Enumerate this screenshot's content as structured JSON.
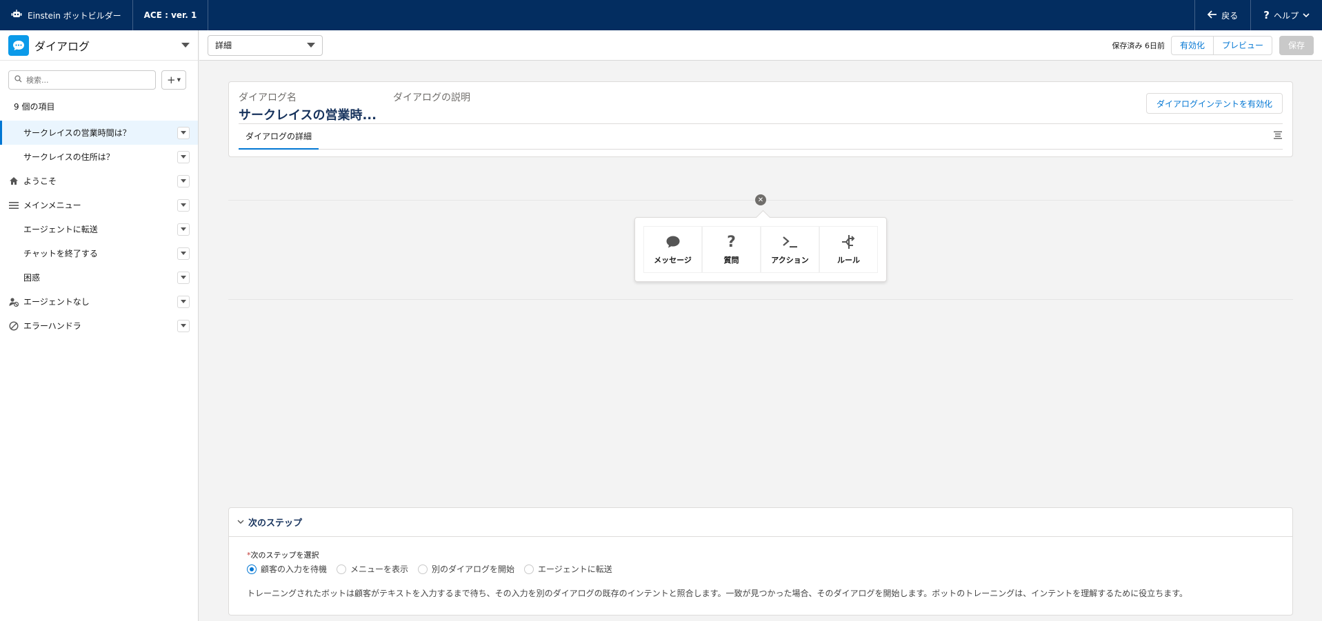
{
  "colors": {
    "topbar": "#032d60",
    "accent": "#0176d3",
    "dialog_icon_bg": "#0b9ae9"
  },
  "topbar": {
    "brand": "Einstein ボットビルダー",
    "bot_version": "ACE : ver. 1",
    "back_label": "戻る",
    "help_label": "ヘルプ"
  },
  "sidebar": {
    "title": "ダイアログ",
    "search_placeholder": "検索...",
    "count_label": "9 個の項目",
    "items": [
      {
        "label": "サークレイスの営業時間は？",
        "icon": ""
      },
      {
        "label": "サークレイスの住所は？",
        "icon": ""
      },
      {
        "label": "ようこそ",
        "icon": "home-icon"
      },
      {
        "label": "メインメニュー",
        "icon": "menu-icon"
      },
      {
        "label": "エージェントに転送",
        "icon": ""
      },
      {
        "label": "チャットを終了する",
        "icon": ""
      },
      {
        "label": "困惑",
        "icon": ""
      },
      {
        "label": "エージェントなし",
        "icon": "agent-off-icon"
      },
      {
        "label": "エラーハンドラ",
        "icon": "ban-icon"
      }
    ]
  },
  "toolbar": {
    "view_select": "詳細",
    "saved_text": "保存済み 6日前",
    "activate_label": "有効化",
    "preview_label": "プレビュー",
    "save_label": "保存"
  },
  "dialog_card": {
    "name_label": "ダイアログ名",
    "name_value": "サークレイスの営業時...",
    "description_label": "ダイアログの説明",
    "enable_intent_label": "ダイアログインテントを有効化",
    "tab_label": "ダイアログの詳細"
  },
  "step_menu": {
    "options": [
      {
        "label": "メッセージ",
        "icon": "message-icon"
      },
      {
        "label": "質問",
        "icon": "question-icon"
      },
      {
        "label": "アクション",
        "icon": "action-icon"
      },
      {
        "label": "ルール",
        "icon": "rule-icon"
      }
    ]
  },
  "next_steps": {
    "title": "次のステップ",
    "required_marker": "*",
    "select_label": "次のステップを選択",
    "options": [
      {
        "label": "顧客の入力を待機",
        "selected": true
      },
      {
        "label": "メニューを表示",
        "selected": false
      },
      {
        "label": "別のダイアログを開始",
        "selected": false
      },
      {
        "label": "エージェントに転送",
        "selected": false
      }
    ],
    "description": "トレーニングされたボットは顧客がテキストを入力するまで待ち、その入力を別のダイアログの既存のインテントと照合します。一致が見つかった場合、そのダイアログを開始します。ボットのトレーニングは、インテントを理解するために役立ちます。"
  }
}
